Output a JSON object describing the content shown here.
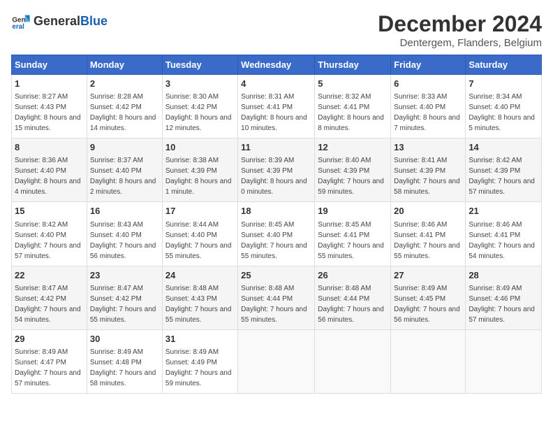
{
  "logo": {
    "text_general": "General",
    "text_blue": "Blue"
  },
  "title": "December 2024",
  "subtitle": "Dentergem, Flanders, Belgium",
  "header_color": "#3a6bc9",
  "days_of_week": [
    "Sunday",
    "Monday",
    "Tuesday",
    "Wednesday",
    "Thursday",
    "Friday",
    "Saturday"
  ],
  "weeks": [
    [
      {
        "day": "1",
        "sunrise": "8:27 AM",
        "sunset": "4:43 PM",
        "daylight": "8 hours and 15 minutes."
      },
      {
        "day": "2",
        "sunrise": "8:28 AM",
        "sunset": "4:42 PM",
        "daylight": "8 hours and 14 minutes."
      },
      {
        "day": "3",
        "sunrise": "8:30 AM",
        "sunset": "4:42 PM",
        "daylight": "8 hours and 12 minutes."
      },
      {
        "day": "4",
        "sunrise": "8:31 AM",
        "sunset": "4:41 PM",
        "daylight": "8 hours and 10 minutes."
      },
      {
        "day": "5",
        "sunrise": "8:32 AM",
        "sunset": "4:41 PM",
        "daylight": "8 hours and 8 minutes."
      },
      {
        "day": "6",
        "sunrise": "8:33 AM",
        "sunset": "4:40 PM",
        "daylight": "8 hours and 7 minutes."
      },
      {
        "day": "7",
        "sunrise": "8:34 AM",
        "sunset": "4:40 PM",
        "daylight": "8 hours and 5 minutes."
      }
    ],
    [
      {
        "day": "8",
        "sunrise": "8:36 AM",
        "sunset": "4:40 PM",
        "daylight": "8 hours and 4 minutes."
      },
      {
        "day": "9",
        "sunrise": "8:37 AM",
        "sunset": "4:40 PM",
        "daylight": "8 hours and 2 minutes."
      },
      {
        "day": "10",
        "sunrise": "8:38 AM",
        "sunset": "4:39 PM",
        "daylight": "8 hours and 1 minute."
      },
      {
        "day": "11",
        "sunrise": "8:39 AM",
        "sunset": "4:39 PM",
        "daylight": "8 hours and 0 minutes."
      },
      {
        "day": "12",
        "sunrise": "8:40 AM",
        "sunset": "4:39 PM",
        "daylight": "7 hours and 59 minutes."
      },
      {
        "day": "13",
        "sunrise": "8:41 AM",
        "sunset": "4:39 PM",
        "daylight": "7 hours and 58 minutes."
      },
      {
        "day": "14",
        "sunrise": "8:42 AM",
        "sunset": "4:39 PM",
        "daylight": "7 hours and 57 minutes."
      }
    ],
    [
      {
        "day": "15",
        "sunrise": "8:42 AM",
        "sunset": "4:40 PM",
        "daylight": "7 hours and 57 minutes."
      },
      {
        "day": "16",
        "sunrise": "8:43 AM",
        "sunset": "4:40 PM",
        "daylight": "7 hours and 56 minutes."
      },
      {
        "day": "17",
        "sunrise": "8:44 AM",
        "sunset": "4:40 PM",
        "daylight": "7 hours and 55 minutes."
      },
      {
        "day": "18",
        "sunrise": "8:45 AM",
        "sunset": "4:40 PM",
        "daylight": "7 hours and 55 minutes."
      },
      {
        "day": "19",
        "sunrise": "8:45 AM",
        "sunset": "4:41 PM",
        "daylight": "7 hours and 55 minutes."
      },
      {
        "day": "20",
        "sunrise": "8:46 AM",
        "sunset": "4:41 PM",
        "daylight": "7 hours and 55 minutes."
      },
      {
        "day": "21",
        "sunrise": "8:46 AM",
        "sunset": "4:41 PM",
        "daylight": "7 hours and 54 minutes."
      }
    ],
    [
      {
        "day": "22",
        "sunrise": "8:47 AM",
        "sunset": "4:42 PM",
        "daylight": "7 hours and 54 minutes."
      },
      {
        "day": "23",
        "sunrise": "8:47 AM",
        "sunset": "4:42 PM",
        "daylight": "7 hours and 55 minutes."
      },
      {
        "day": "24",
        "sunrise": "8:48 AM",
        "sunset": "4:43 PM",
        "daylight": "7 hours and 55 minutes."
      },
      {
        "day": "25",
        "sunrise": "8:48 AM",
        "sunset": "4:44 PM",
        "daylight": "7 hours and 55 minutes."
      },
      {
        "day": "26",
        "sunrise": "8:48 AM",
        "sunset": "4:44 PM",
        "daylight": "7 hours and 56 minutes."
      },
      {
        "day": "27",
        "sunrise": "8:49 AM",
        "sunset": "4:45 PM",
        "daylight": "7 hours and 56 minutes."
      },
      {
        "day": "28",
        "sunrise": "8:49 AM",
        "sunset": "4:46 PM",
        "daylight": "7 hours and 57 minutes."
      }
    ],
    [
      {
        "day": "29",
        "sunrise": "8:49 AM",
        "sunset": "4:47 PM",
        "daylight": "7 hours and 57 minutes."
      },
      {
        "day": "30",
        "sunrise": "8:49 AM",
        "sunset": "4:48 PM",
        "daylight": "7 hours and 58 minutes."
      },
      {
        "day": "31",
        "sunrise": "8:49 AM",
        "sunset": "4:49 PM",
        "daylight": "7 hours and 59 minutes."
      },
      null,
      null,
      null,
      null
    ]
  ]
}
